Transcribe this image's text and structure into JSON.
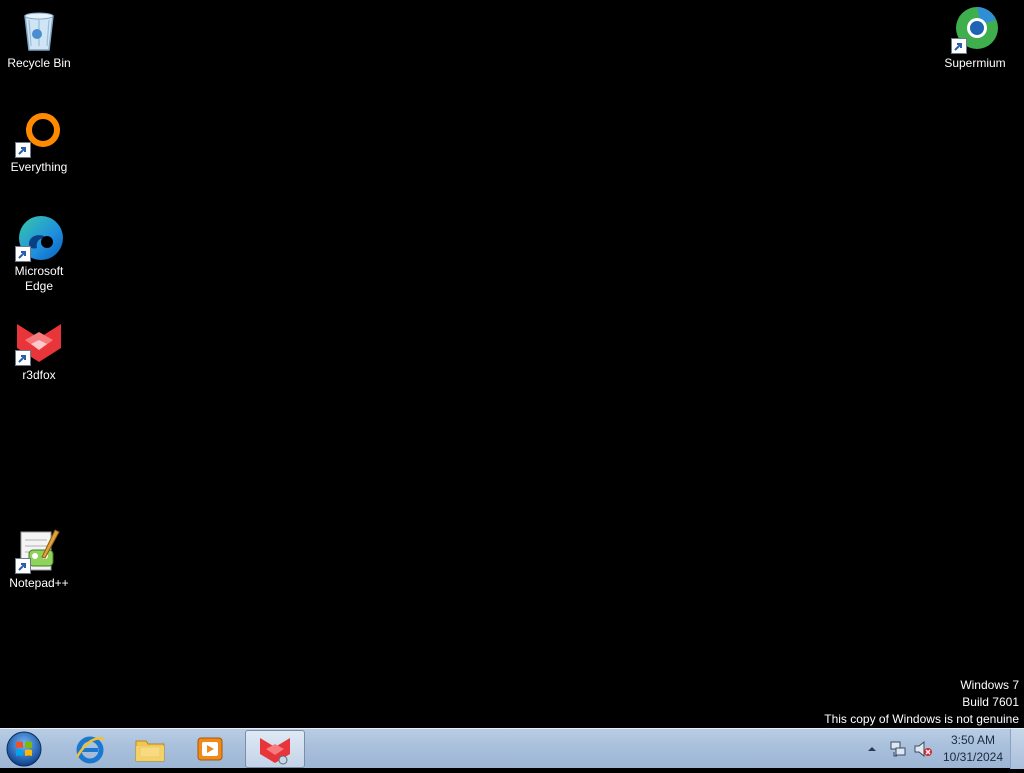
{
  "desktop": {
    "icons": [
      {
        "label": "Recycle Bin",
        "icon": "recycle-bin-icon"
      },
      {
        "label": "Everything",
        "icon": "everything-icon"
      },
      {
        "label": "Microsoft Edge",
        "icon": "microsoft-edge-icon"
      },
      {
        "label": "r3dfox",
        "icon": "r3dfox-icon"
      },
      {
        "label": "Notepad++",
        "icon": "notepad-plus-plus-icon"
      },
      {
        "label": "Supermium",
        "icon": "supermium-icon"
      }
    ]
  },
  "watermark": {
    "line1": "Windows 7",
    "line2": "Build 7601",
    "line3": "This copy of Windows is not genuine"
  },
  "taskbar": {
    "pinned": [
      {
        "icon": "internet-explorer-icon"
      },
      {
        "icon": "file-explorer-icon"
      },
      {
        "icon": "media-player-icon"
      },
      {
        "icon": "r3dfox-icon",
        "active": true
      }
    ]
  },
  "tray": {
    "time": "3:50 AM",
    "date": "10/31/2024",
    "icons": [
      "show-hidden-icons-arrow",
      "network-icon",
      "volume-muted-icon"
    ]
  },
  "colors": {
    "desktop_bg": "#000000",
    "taskbar_bg": "#a8c0dc"
  }
}
